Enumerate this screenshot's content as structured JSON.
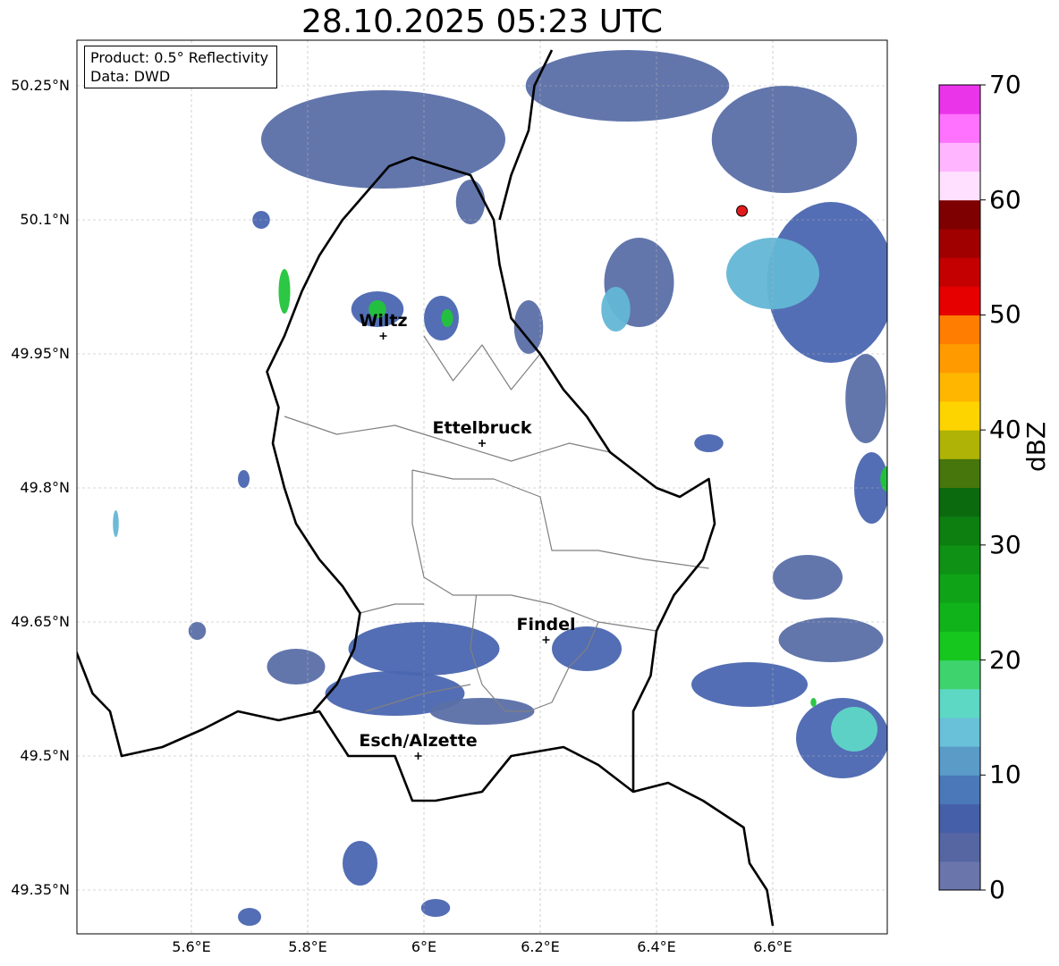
{
  "title": "28.10.2025 05:23 UTC",
  "info": {
    "product": "Product: 0.5° Reflectivity",
    "source": "Data: DWD"
  },
  "axes": {
    "lat_ticks": [
      "50.25°N",
      "50.1°N",
      "49.95°N",
      "49.8°N",
      "49.65°N",
      "49.5°N",
      "49.35°N"
    ],
    "lon_ticks": [
      "5.6°E",
      "5.8°E",
      "6°E",
      "6.2°E",
      "6.4°E",
      "6.6°E"
    ]
  },
  "cities": [
    {
      "name": "Wiltz",
      "lon": 5.93,
      "lat": 49.97
    },
    {
      "name": "Ettelbruck",
      "lon": 6.1,
      "lat": 49.85
    },
    {
      "name": "Findel",
      "lon": 6.21,
      "lat": 49.63
    },
    {
      "name": "Esch/Alzette",
      "lon": 5.99,
      "lat": 49.5
    }
  ],
  "radar_site": {
    "lon": 6.547,
    "lat": 50.11,
    "color": "#e31a1c"
  },
  "colorbar": {
    "label": "dBZ",
    "ticks": [
      "0",
      "10",
      "20",
      "30",
      "40",
      "50",
      "60",
      "70"
    ],
    "colors": [
      "#6a75ab",
      "#5566a3",
      "#4560a8",
      "#4a78b8",
      "#5a9bc8",
      "#68c1d9",
      "#5cd8c4",
      "#3ed36c",
      "#16c71d",
      "#10b31a",
      "#0fa317",
      "#0e9114",
      "#0d7f11",
      "#0b6a0e",
      "#46760c",
      "#aeb306",
      "#fed400",
      "#ffb600",
      "#ff9a00",
      "#ff7d00",
      "#e60000",
      "#c40000",
      "#a00000",
      "#7e0000",
      "#ffe0ff",
      "#ffb5ff",
      "#ff72ff",
      "#ea34ea"
    ]
  },
  "colors": {
    "precip_weak": "#5a6fa8",
    "precip_medium": "#4a66b0",
    "precip_light_blue": "#63b7d6",
    "precip_cyan": "#5fd6c8",
    "precip_green": "#21c43a",
    "border_national": "#000000",
    "border_cantonal": "#808080"
  },
  "precip_cells": [
    {
      "lon": 6.35,
      "lat": 50.25,
      "w": 0.35,
      "h": 0.08,
      "level": 0
    },
    {
      "lon": 5.93,
      "lat": 50.19,
      "w": 0.42,
      "h": 0.11,
      "level": 0
    },
    {
      "lon": 6.08,
      "lat": 50.12,
      "w": 0.05,
      "h": 0.05,
      "level": 0
    },
    {
      "lon": 5.72,
      "lat": 50.1,
      "w": 0.03,
      "h": 0.02,
      "level": 1
    },
    {
      "lon": 6.62,
      "lat": 50.19,
      "w": 0.25,
      "h": 0.12,
      "level": 0
    },
    {
      "lon": 6.7,
      "lat": 50.03,
      "w": 0.22,
      "h": 0.18,
      "level": 1
    },
    {
      "lon": 6.6,
      "lat": 50.04,
      "w": 0.16,
      "h": 0.08,
      "level": 2
    },
    {
      "lon": 6.37,
      "lat": 50.03,
      "w": 0.12,
      "h": 0.1,
      "level": 0
    },
    {
      "lon": 6.33,
      "lat": 50.0,
      "w": 0.05,
      "h": 0.05,
      "level": 2
    },
    {
      "lon": 6.18,
      "lat": 49.98,
      "w": 0.05,
      "h": 0.06,
      "level": 0
    },
    {
      "lon": 5.76,
      "lat": 50.02,
      "w": 0.02,
      "h": 0.05,
      "level": 4
    },
    {
      "lon": 5.92,
      "lat": 50.0,
      "w": 0.09,
      "h": 0.04,
      "level": 1
    },
    {
      "lon": 5.92,
      "lat": 50.0,
      "w": 0.03,
      "h": 0.02,
      "level": 4
    },
    {
      "lon": 6.03,
      "lat": 49.99,
      "w": 0.06,
      "h": 0.05,
      "level": 1
    },
    {
      "lon": 6.04,
      "lat": 49.99,
      "w": 0.02,
      "h": 0.02,
      "level": 4
    },
    {
      "lon": 6.76,
      "lat": 49.9,
      "w": 0.07,
      "h": 0.1,
      "level": 0
    },
    {
      "lon": 6.77,
      "lat": 49.8,
      "w": 0.06,
      "h": 0.08,
      "level": 1
    },
    {
      "lon": 6.8,
      "lat": 49.81,
      "w": 0.03,
      "h": 0.03,
      "level": 4
    },
    {
      "lon": 6.49,
      "lat": 49.85,
      "w": 0.05,
      "h": 0.02,
      "level": 1
    },
    {
      "lon": 6.66,
      "lat": 49.7,
      "w": 0.12,
      "h": 0.05,
      "level": 0
    },
    {
      "lon": 6.7,
      "lat": 49.63,
      "w": 0.18,
      "h": 0.05,
      "level": 0
    },
    {
      "lon": 6.56,
      "lat": 49.58,
      "w": 0.2,
      "h": 0.05,
      "level": 1
    },
    {
      "lon": 6.72,
      "lat": 49.52,
      "w": 0.16,
      "h": 0.09,
      "level": 1
    },
    {
      "lon": 6.74,
      "lat": 49.53,
      "w": 0.08,
      "h": 0.05,
      "level": 3
    },
    {
      "lon": 6.67,
      "lat": 49.56,
      "w": 0.01,
      "h": 0.01,
      "level": 4
    },
    {
      "lon": 6.0,
      "lat": 49.62,
      "w": 0.26,
      "h": 0.06,
      "level": 1
    },
    {
      "lon": 6.28,
      "lat": 49.62,
      "w": 0.12,
      "h": 0.05,
      "level": 1
    },
    {
      "lon": 5.95,
      "lat": 49.57,
      "w": 0.24,
      "h": 0.05,
      "level": 1
    },
    {
      "lon": 5.78,
      "lat": 49.6,
      "w": 0.1,
      "h": 0.04,
      "level": 0
    },
    {
      "lon": 6.1,
      "lat": 49.55,
      "w": 0.18,
      "h": 0.03,
      "level": 0
    },
    {
      "lon": 5.89,
      "lat": 49.38,
      "w": 0.06,
      "h": 0.05,
      "level": 1
    },
    {
      "lon": 6.02,
      "lat": 49.33,
      "w": 0.05,
      "h": 0.02,
      "level": 1
    },
    {
      "lon": 5.7,
      "lat": 49.32,
      "w": 0.04,
      "h": 0.02,
      "level": 1
    },
    {
      "lon": 5.47,
      "lat": 49.76,
      "w": 0.01,
      "h": 0.03,
      "level": 2
    },
    {
      "lon": 5.69,
      "lat": 49.81,
      "w": 0.02,
      "h": 0.02,
      "level": 1
    },
    {
      "lon": 5.61,
      "lat": 49.64,
      "w": 0.03,
      "h": 0.02,
      "level": 0
    }
  ],
  "borders": {
    "national": [
      [
        [
          5.4,
          49.62
        ],
        [
          5.43,
          49.57
        ],
        [
          5.46,
          49.55
        ],
        [
          5.48,
          49.5
        ],
        [
          5.55,
          49.51
        ],
        [
          5.62,
          49.53
        ],
        [
          5.68,
          49.55
        ],
        [
          5.75,
          49.54
        ],
        [
          5.82,
          49.55
        ],
        [
          5.87,
          49.5
        ],
        [
          5.95,
          49.5
        ],
        [
          5.98,
          49.45
        ],
        [
          6.02,
          49.45
        ],
        [
          6.1,
          49.46
        ],
        [
          6.15,
          49.5
        ],
        [
          6.24,
          49.51
        ],
        [
          6.3,
          49.49
        ],
        [
          6.36,
          49.46
        ],
        [
          6.42,
          49.47
        ],
        [
          6.48,
          49.45
        ],
        [
          6.55,
          49.42
        ],
        [
          6.56,
          49.38
        ],
        [
          6.59,
          49.35
        ],
        [
          6.6,
          49.31
        ]
      ],
      [
        [
          5.81,
          49.55
        ],
        [
          5.85,
          49.58
        ],
        [
          5.88,
          49.62
        ],
        [
          5.89,
          49.66
        ],
        [
          5.86,
          49.69
        ],
        [
          5.82,
          49.72
        ],
        [
          5.78,
          49.76
        ],
        [
          5.76,
          49.8
        ],
        [
          5.74,
          49.85
        ],
        [
          5.75,
          49.89
        ],
        [
          5.73,
          49.93
        ],
        [
          5.76,
          49.97
        ],
        [
          5.79,
          50.02
        ],
        [
          5.82,
          50.06
        ],
        [
          5.86,
          50.1
        ],
        [
          5.9,
          50.13
        ],
        [
          5.94,
          50.16
        ],
        [
          5.98,
          50.17
        ],
        [
          6.03,
          50.16
        ],
        [
          6.08,
          50.15
        ],
        [
          6.12,
          50.1
        ],
        [
          6.13,
          50.05
        ],
        [
          6.15,
          49.99
        ],
        [
          6.2,
          49.95
        ],
        [
          6.24,
          49.91
        ],
        [
          6.28,
          49.88
        ],
        [
          6.32,
          49.84
        ],
        [
          6.36,
          49.82
        ],
        [
          6.4,
          49.8
        ],
        [
          6.44,
          49.79
        ],
        [
          6.49,
          49.81
        ],
        [
          6.5,
          49.76
        ],
        [
          6.48,
          49.72
        ],
        [
          6.43,
          49.68
        ],
        [
          6.4,
          49.64
        ],
        [
          6.39,
          49.59
        ],
        [
          6.36,
          49.55
        ],
        [
          6.36,
          49.46
        ]
      ],
      [
        [
          6.13,
          50.1
        ],
        [
          6.15,
          50.15
        ],
        [
          6.18,
          50.2
        ],
        [
          6.19,
          50.25
        ],
        [
          6.22,
          50.29
        ]
      ]
    ],
    "cantonal": [
      [
        [
          5.76,
          49.88
        ],
        [
          5.85,
          49.86
        ],
        [
          5.95,
          49.87
        ],
        [
          6.05,
          49.85
        ],
        [
          6.15,
          49.83
        ],
        [
          6.25,
          49.85
        ],
        [
          6.32,
          49.84
        ]
      ],
      [
        [
          6.0,
          49.97
        ],
        [
          6.05,
          49.92
        ],
        [
          6.1,
          49.96
        ],
        [
          6.15,
          49.91
        ],
        [
          6.2,
          49.95
        ]
      ],
      [
        [
          5.98,
          49.82
        ],
        [
          6.05,
          49.81
        ],
        [
          6.12,
          49.81
        ],
        [
          6.2,
          49.79
        ],
        [
          6.22,
          49.73
        ],
        [
          6.3,
          49.73
        ],
        [
          6.38,
          49.72
        ],
        [
          6.49,
          49.71
        ]
      ],
      [
        [
          5.98,
          49.82
        ],
        [
          5.98,
          49.76
        ],
        [
          6.0,
          49.7
        ],
        [
          6.05,
          49.68
        ],
        [
          6.15,
          49.68
        ],
        [
          6.22,
          49.67
        ],
        [
          6.3,
          49.65
        ],
        [
          6.4,
          49.64
        ]
      ],
      [
        [
          6.09,
          49.68
        ],
        [
          6.08,
          49.62
        ],
        [
          6.1,
          49.58
        ],
        [
          6.14,
          49.55
        ],
        [
          6.18,
          49.55
        ],
        [
          6.22,
          49.56
        ],
        [
          6.25,
          49.6
        ],
        [
          6.28,
          49.62
        ],
        [
          6.3,
          49.65
        ]
      ],
      [
        [
          5.89,
          49.66
        ],
        [
          5.95,
          49.67
        ],
        [
          6.0,
          49.67
        ]
      ],
      [
        [
          5.9,
          49.55
        ],
        [
          6.0,
          49.57
        ],
        [
          6.08,
          49.58
        ]
      ]
    ]
  }
}
